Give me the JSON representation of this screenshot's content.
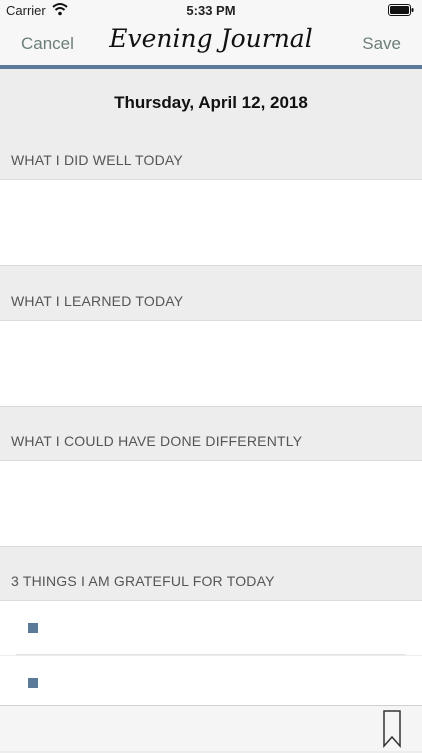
{
  "status_bar": {
    "carrier": "Carrier",
    "time": "5:33 PM"
  },
  "nav": {
    "cancel_label": "Cancel",
    "title": "Evening Journal",
    "save_label": "Save"
  },
  "date": "Thursday, April 12, 2018",
  "sections": [
    {
      "label": "WHAT I DID WELL TODAY"
    },
    {
      "label": "WHAT I LEARNED TODAY"
    },
    {
      "label": "WHAT I COULD HAVE DONE DIFFERENTLY"
    },
    {
      "label": "3 THINGS I AM GRATEFUL FOR TODAY"
    }
  ],
  "colors": {
    "accent": "#5b7a99",
    "nav_button": "#6c7e78"
  },
  "icons": {
    "status": [
      "wifi-icon",
      "battery-icon"
    ],
    "toolbar": [
      "bookmark-icon"
    ]
  }
}
